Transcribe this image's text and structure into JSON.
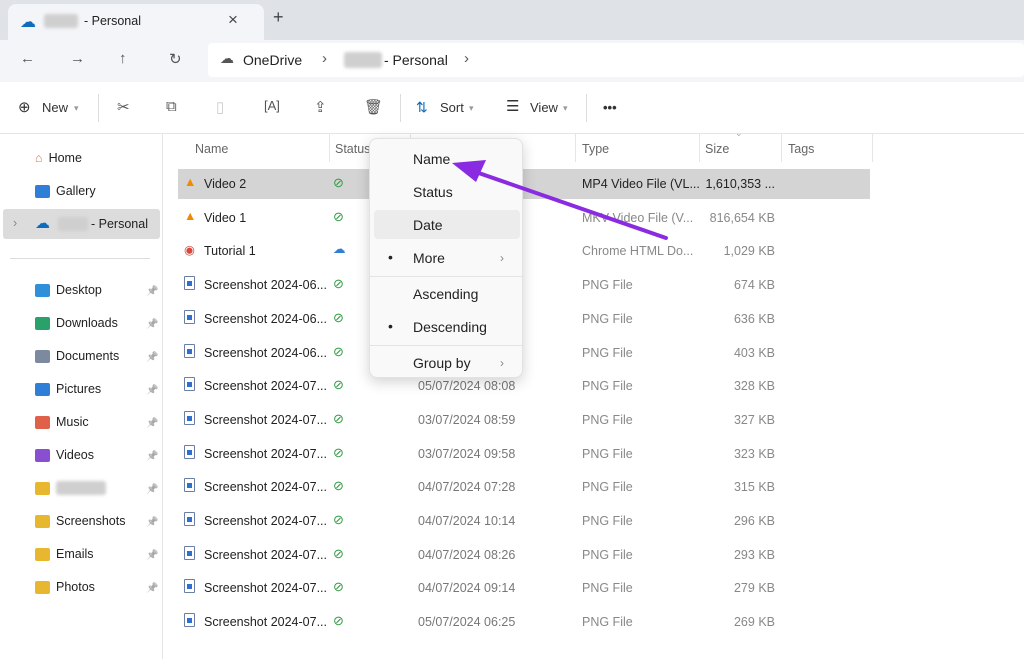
{
  "tab": {
    "title": "- Personal",
    "close": "×",
    "new_tab": "+"
  },
  "address": {
    "crumbs": [
      "OneDrive",
      "- Personal"
    ],
    "sep": "›"
  },
  "toolbar": {
    "new": "New",
    "sort": "Sort",
    "view": "View",
    "more": "•••"
  },
  "sidebar": {
    "top": [
      {
        "label": "Home",
        "icon": "home-icon"
      },
      {
        "label": "Gallery",
        "icon": "gallery-icon"
      },
      {
        "label": "- Personal",
        "icon": "onedrive-icon",
        "selected": true
      }
    ],
    "quick": [
      {
        "label": "Desktop",
        "color": "#2f8fd8"
      },
      {
        "label": "Downloads",
        "color": "#2aa06a"
      },
      {
        "label": "Documents",
        "color": "#7c8aa0"
      },
      {
        "label": "Pictures",
        "color": "#2f7fd8"
      },
      {
        "label": "Music",
        "color": "#e0614a"
      },
      {
        "label": "Videos",
        "color": "#8a4fd0"
      },
      {
        "label": "",
        "color": "#e8b730",
        "blurred": true
      },
      {
        "label": "Screenshots",
        "color": "#e8b730"
      },
      {
        "label": "Emails",
        "color": "#e8b730"
      },
      {
        "label": "Photos",
        "color": "#e8b730"
      }
    ]
  },
  "columns": [
    "Name",
    "Status",
    "Type",
    "Size",
    "Tags"
  ],
  "files": [
    {
      "name": "Video 2",
      "icon": "vlc",
      "status": "ok",
      "date": "",
      "type": "MP4 Video File (VL...",
      "size": "1,610,353 ...",
      "selected": true
    },
    {
      "name": "Video 1",
      "icon": "vlc",
      "status": "ok",
      "date": "",
      "type": "MKV Video File (V...",
      "size": "816,654 KB"
    },
    {
      "name": "Tutorial 1",
      "icon": "chrome",
      "status": "cloud",
      "date": "",
      "type": "Chrome HTML Do...",
      "size": "1,029 KB"
    },
    {
      "name": "Screenshot 2024-06...",
      "icon": "png",
      "status": "ok",
      "date": "",
      "type": "PNG File",
      "size": "674 KB"
    },
    {
      "name": "Screenshot 2024-06...",
      "icon": "png",
      "status": "ok",
      "date": "",
      "type": "PNG File",
      "size": "636 KB"
    },
    {
      "name": "Screenshot 2024-06...",
      "icon": "png",
      "status": "ok",
      "date": "",
      "type": "PNG File",
      "size": "403 KB"
    },
    {
      "name": "Screenshot 2024-07...",
      "icon": "png",
      "status": "ok",
      "date": "05/07/2024 08:08",
      "type": "PNG File",
      "size": "328 KB"
    },
    {
      "name": "Screenshot 2024-07...",
      "icon": "png",
      "status": "ok",
      "date": "03/07/2024 08:59",
      "type": "PNG File",
      "size": "327 KB"
    },
    {
      "name": "Screenshot 2024-07...",
      "icon": "png",
      "status": "ok",
      "date": "03/07/2024 09:58",
      "type": "PNG File",
      "size": "323 KB"
    },
    {
      "name": "Screenshot 2024-07...",
      "icon": "png",
      "status": "ok",
      "date": "04/07/2024 07:28",
      "type": "PNG File",
      "size": "315 KB"
    },
    {
      "name": "Screenshot 2024-07...",
      "icon": "png",
      "status": "ok",
      "date": "04/07/2024 10:14",
      "type": "PNG File",
      "size": "296 KB"
    },
    {
      "name": "Screenshot 2024-07...",
      "icon": "png",
      "status": "ok",
      "date": "04/07/2024 08:26",
      "type": "PNG File",
      "size": "293 KB"
    },
    {
      "name": "Screenshot 2024-07...",
      "icon": "png",
      "status": "ok",
      "date": "04/07/2024 09:14",
      "type": "PNG File",
      "size": "279 KB"
    },
    {
      "name": "Screenshot 2024-07...",
      "icon": "png",
      "status": "ok",
      "date": "05/07/2024 06:25",
      "type": "PNG File",
      "size": "269 KB"
    }
  ],
  "sort_menu": {
    "items": [
      "Name",
      "Status",
      "Date",
      "More",
      "Ascending",
      "Descending",
      "Group by"
    ],
    "hovered": "Date",
    "checked": [
      "More",
      "Descending"
    ]
  },
  "colors": {
    "accent": "#0f6cbd",
    "annotation_arrow": "#8a2be2",
    "selection": "#cfcfcf"
  }
}
